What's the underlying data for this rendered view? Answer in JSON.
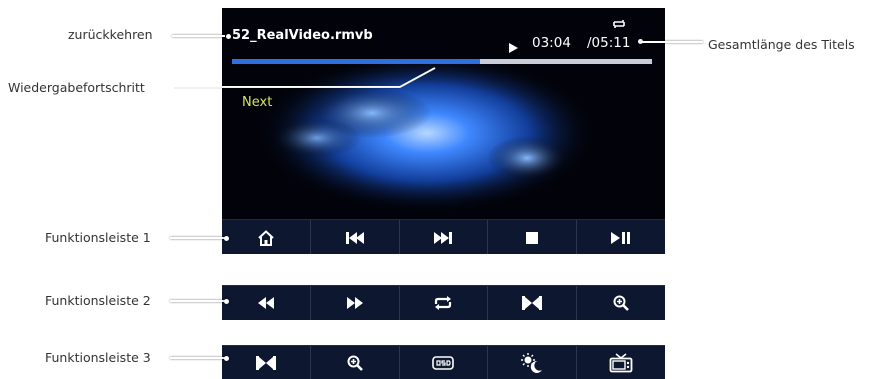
{
  "callouts": {
    "back": "zurückkehren",
    "progress": "Wiedergabefortschritt",
    "total_length": "Gesamtlänge des Titels",
    "bar1": "Funktionsleiste 1",
    "bar2": "Funktionsleiste 2",
    "bar3": "Funktionsleiste 3"
  },
  "player": {
    "file_name": "52_RealVideo.rmvb",
    "current_time": "03:04",
    "total_time": "/05:11",
    "progress_fraction": 0.59,
    "next_label": "Next"
  },
  "toolbar1": [
    "home-icon",
    "previous-track-icon",
    "next-track-icon",
    "stop-icon",
    "play-pause-icon"
  ],
  "toolbar2": [
    "rewind-icon",
    "fast-forward-icon",
    "repeat-icon",
    "aspect-ratio-icon",
    "zoom-icon"
  ],
  "toolbar3": [
    "aspect-ratio-icon",
    "zoom-icon",
    "osd-icon",
    "brightness-icon",
    "tv-icon"
  ],
  "colors": {
    "toolbar_bg": "#0d1730",
    "progress_fill": "#2f6fe0",
    "next_text": "#d8e35a"
  }
}
